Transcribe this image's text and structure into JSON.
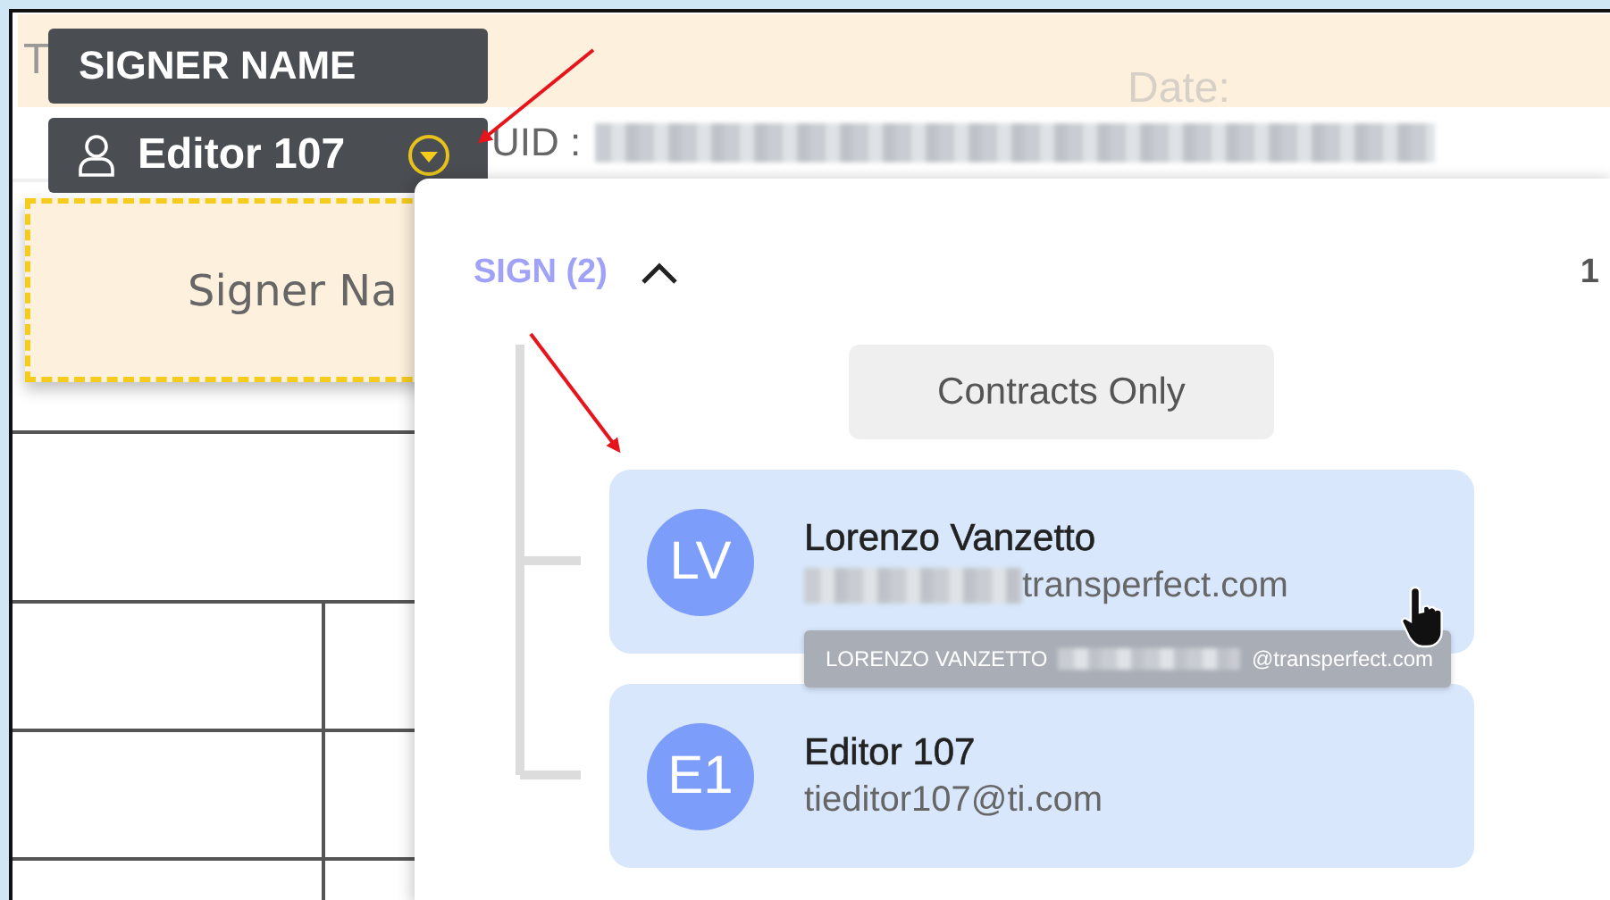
{
  "document": {
    "title_label": "T",
    "date_label": "Date:",
    "uid_label": "UID :",
    "signer_field": "Signer Na"
  },
  "signer_tag": {
    "label": "SIGNER NAME",
    "name": "Editor 107"
  },
  "dropdown": {
    "section": "SIGN (2)",
    "expanded": true,
    "count": "1",
    "filter_button": "Contracts Only",
    "recipients": [
      {
        "initials": "LV",
        "name": "Lorenzo Vanzetto",
        "email": "transperfect.com",
        "email_redacted": true
      },
      {
        "initials": "E1",
        "name": "Editor 107",
        "email": "tieditor107@ti.com",
        "email_redacted": false
      }
    ],
    "tooltip": {
      "name": "LORENZO VANZETTO",
      "email": "@transperfect.com"
    }
  }
}
